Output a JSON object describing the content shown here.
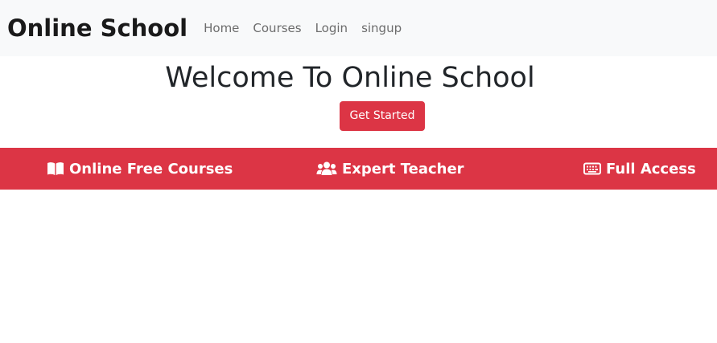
{
  "navbar": {
    "brand": "Online School",
    "links": [
      "Home",
      "Courses",
      "Login",
      "singup"
    ]
  },
  "hero": {
    "title": "Welcome To Online School",
    "button_label": "Get Started"
  },
  "features": [
    {
      "icon": "book-open-icon",
      "label": "Online Free Courses"
    },
    {
      "icon": "users-icon",
      "label": "Expert Teacher"
    },
    {
      "icon": "keyboard-icon",
      "label": "Full Access"
    }
  ],
  "colors": {
    "accent": "#dc3545",
    "navbar_bg": "#f8f9fa",
    "text": "#212529",
    "nav_link": "#6c6c6c"
  }
}
